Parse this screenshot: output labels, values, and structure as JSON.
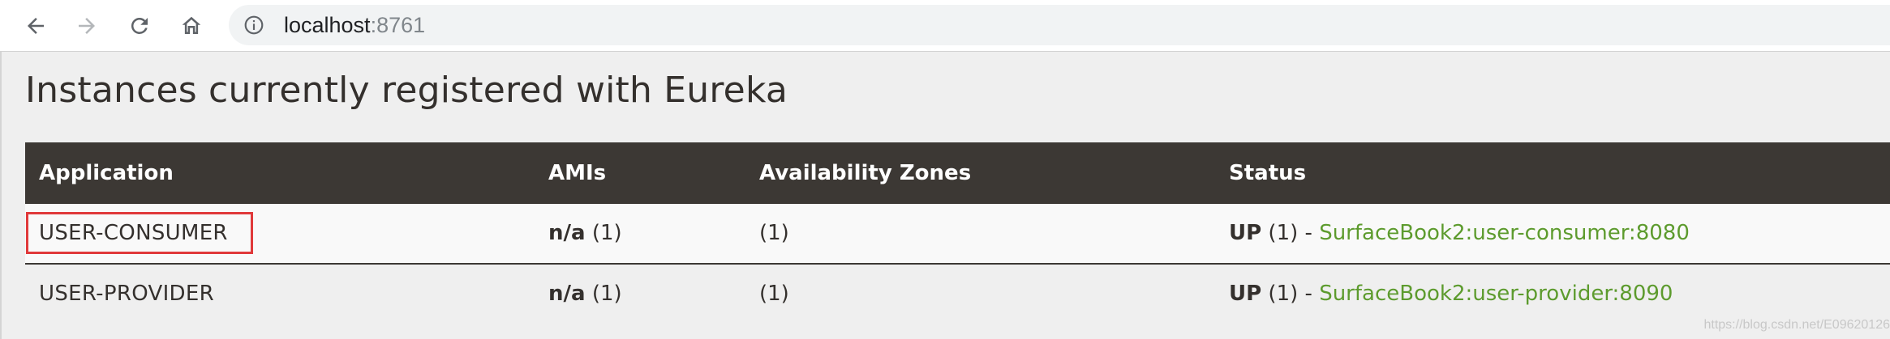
{
  "browser": {
    "url_host": "localhost",
    "url_port": ":8761",
    "icons": {
      "back": "arrow-left-icon",
      "forward": "arrow-right-icon",
      "reload": "reload-icon",
      "home": "home-icon",
      "site_info": "info-icon"
    }
  },
  "page": {
    "heading": "Instances currently registered with Eureka",
    "table": {
      "headers": {
        "application": "Application",
        "amis": "AMIs",
        "zones": "Availability Zones",
        "status": "Status"
      },
      "rows": [
        {
          "application": "USER-CONSUMER",
          "ami_label": "n/a",
          "ami_count": " (1)",
          "zones": "(1)",
          "status_label": "UP",
          "status_count": " (1) - ",
          "instance_link": "SurfaceBook2:user-consumer:8080",
          "highlighted": true
        },
        {
          "application": "USER-PROVIDER",
          "ami_label": "n/a",
          "ami_count": " (1)",
          "zones": "(1)",
          "status_label": "UP",
          "status_count": " (1) - ",
          "instance_link": "SurfaceBook2:user-provider:8090",
          "highlighted": false
        }
      ]
    },
    "watermark": "https://blog.csdn.net/E09620126"
  },
  "colors": {
    "header_bg": "#3c3834",
    "link": "#5d9b2e",
    "highlight_border": "#e0393a",
    "text": "#34302d"
  }
}
